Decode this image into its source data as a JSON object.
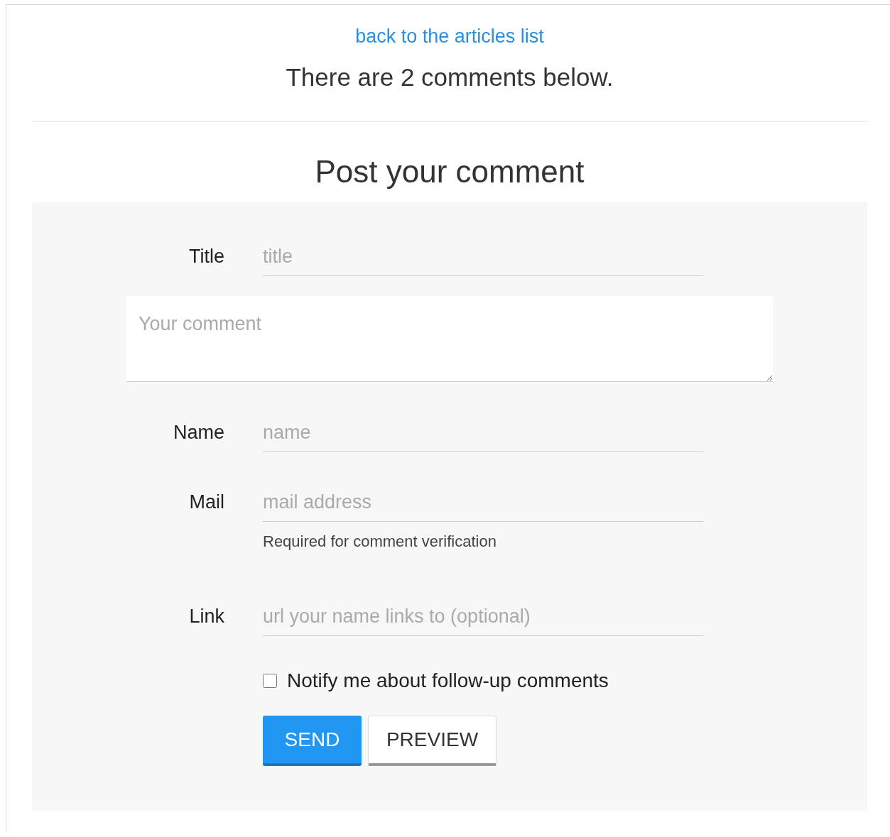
{
  "back_link": "back to the articles list",
  "comment_count": "There are 2 comments below.",
  "form": {
    "heading": "Post your comment",
    "fields": [
      {
        "kind": "input",
        "label": "Title",
        "placeholder": "title"
      },
      {
        "kind": "textarea",
        "placeholder": "Your comment"
      },
      {
        "kind": "input",
        "label": "Name",
        "placeholder": "name"
      },
      {
        "kind": "input",
        "label": "Mail",
        "placeholder": "mail address",
        "help": "Required for comment verification"
      },
      {
        "kind": "input",
        "label": "Link",
        "placeholder": "url your name links to (optional)"
      }
    ],
    "notify": {
      "label": "Notify me about follow-up comments",
      "checked": false
    },
    "buttons": [
      {
        "label": "SEND",
        "kind": "primary"
      },
      {
        "label": "PREVIEW",
        "kind": "secondary"
      }
    ]
  }
}
